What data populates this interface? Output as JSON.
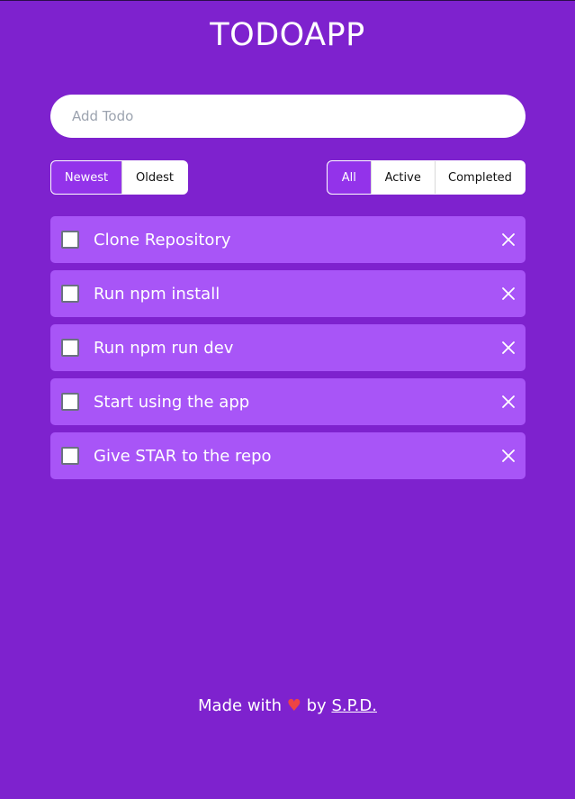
{
  "header": {
    "title": "TODOAPP"
  },
  "add_todo": {
    "placeholder": "Add Todo",
    "value": ""
  },
  "sort": {
    "options": [
      "Newest",
      "Oldest"
    ],
    "selected": "Newest"
  },
  "filter": {
    "options": [
      "All",
      "Active",
      "Completed"
    ],
    "selected": "All"
  },
  "todos": [
    {
      "text": "Clone Repository",
      "completed": false
    },
    {
      "text": "Run npm install",
      "completed": false
    },
    {
      "text": "Run npm run dev",
      "completed": false
    },
    {
      "text": "Start using the app",
      "completed": false
    },
    {
      "text": "Give STAR to the repo",
      "completed": false
    }
  ],
  "footer": {
    "prefix": "Made with",
    "heart": "♥",
    "middle": "by",
    "author": "S.P.D."
  },
  "colors": {
    "background": "#7e22ce",
    "item": "#a855f7",
    "accent": "#9333ea",
    "heart": "#ef4444"
  }
}
